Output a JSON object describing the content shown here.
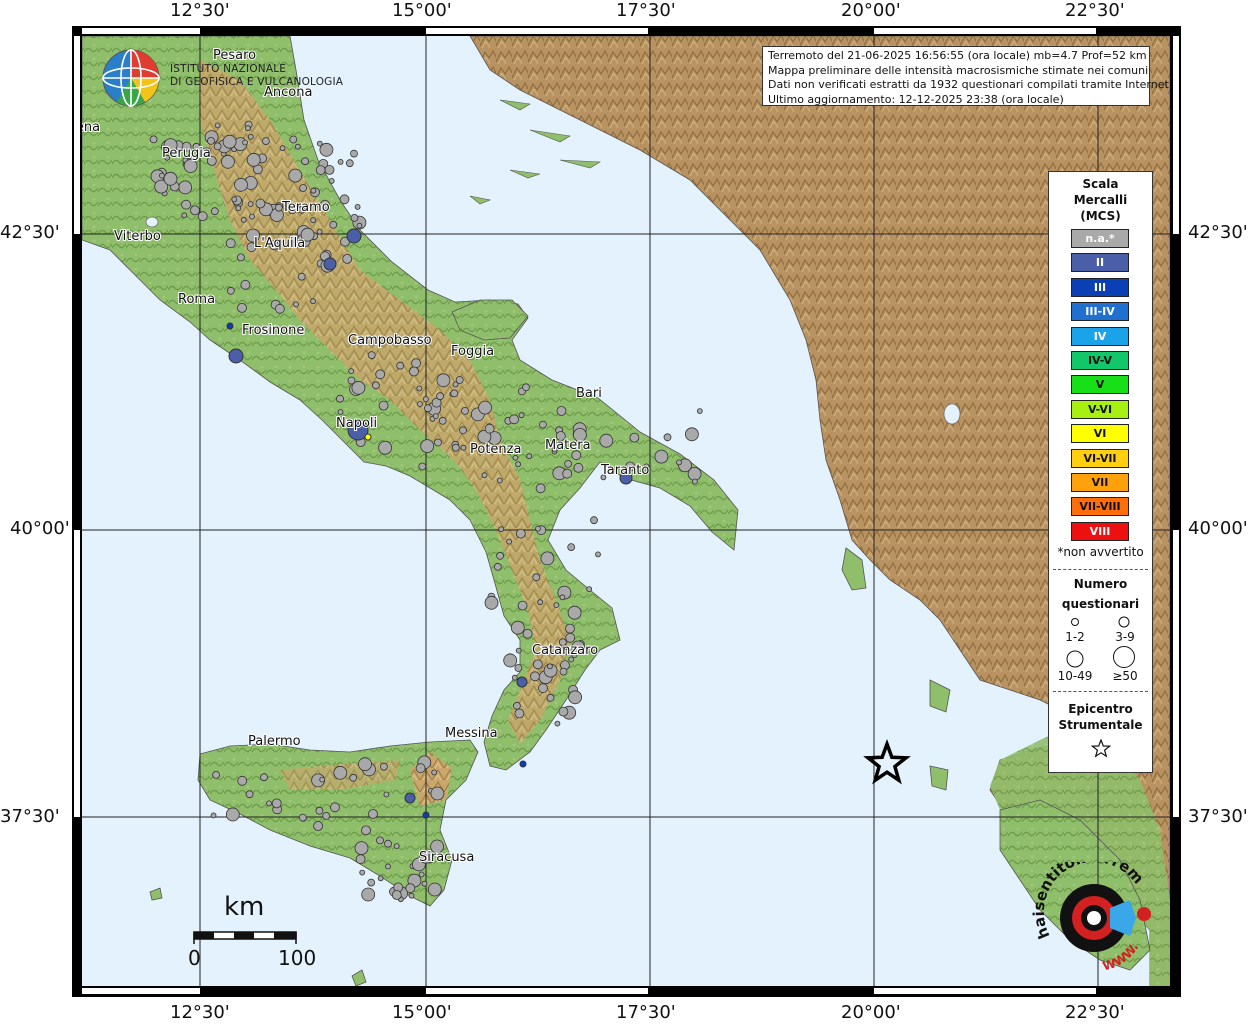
{
  "info": {
    "line1": "Terremoto del 21-06-2025 16:56:55 (ora locale) mb=4.7 Prof=52 km",
    "line2": "Mappa preliminare delle intensità macrosismiche stimate nei comuni",
    "line3": "Dati non verificati estratti da 1932 questionari compilati tramite Internet.",
    "line4": "Ultimo aggiornamento: 12-12-2025 23:38 (ora locale)"
  },
  "ticks": {
    "lon": [
      "12°30'",
      "15°00'",
      "17°30'",
      "20°00'",
      "22°30'"
    ],
    "lat": [
      "42°30'",
      "40°00'",
      "37°30'"
    ]
  },
  "cities": [
    "Pesaro",
    "Ancona",
    "Siena",
    "Perugia",
    "Teramo",
    "Viterbo",
    "L'Aquila",
    "Roma",
    "Frosinone",
    "Campobasso",
    "Foggia",
    "Bari",
    "Napoli",
    "Potenza",
    "Matera",
    "Taranto",
    "Catanzaro",
    "Messina",
    "Palermo",
    "Siracusa"
  ],
  "legend": {
    "title1": "Scala",
    "title2": "Mercalli",
    "title3": "(MCS)",
    "classes": [
      {
        "label": "n.a.*",
        "color": "#a9a9a9",
        "text_color": "#ffffff"
      },
      {
        "label": "II",
        "color": "#4b5fa8",
        "text_color": "#ffffff"
      },
      {
        "label": "III",
        "color": "#0b3fb5",
        "text_color": "#ffffff"
      },
      {
        "label": "III-IV",
        "color": "#1f70d0",
        "text_color": "#ffffff"
      },
      {
        "label": "IV",
        "color": "#1aa3e8",
        "text_color": "#ffffff"
      },
      {
        "label": "IV-V",
        "color": "#12c66a",
        "text_color": "#111111"
      },
      {
        "label": "V",
        "color": "#18e018",
        "text_color": "#111111"
      },
      {
        "label": "V-VI",
        "color": "#a8ef12",
        "text_color": "#111111"
      },
      {
        "label": "VI",
        "color": "#ffff00",
        "text_color": "#111111"
      },
      {
        "label": "VI-VII",
        "color": "#ffcf10",
        "text_color": "#111111"
      },
      {
        "label": "VII",
        "color": "#ffa10c",
        "text_color": "#111111"
      },
      {
        "label": "VII-VIII",
        "color": "#ff6e08",
        "text_color": "#111111"
      },
      {
        "label": "VIII",
        "color": "#ee1010",
        "text_color": "#ffffff"
      }
    ],
    "note": "*non avvertito",
    "count_title1": "Numero",
    "count_title2": "questionari",
    "sizes": [
      "1-2",
      "3-9",
      "10-49",
      "≥50"
    ],
    "epi1": "Epicentro",
    "epi2": "Strumentale"
  },
  "logos": {
    "ingv_line1": "ISTITUTO NAZIONALE",
    "ingv_line2": "DI GEOFISICA E VULCANOLOGIA",
    "hst_text": "haisentitoilterremoto.it",
    "hst_url": "WWW."
  },
  "scalebar": {
    "unit": "km",
    "start": "0",
    "end": "100"
  }
}
